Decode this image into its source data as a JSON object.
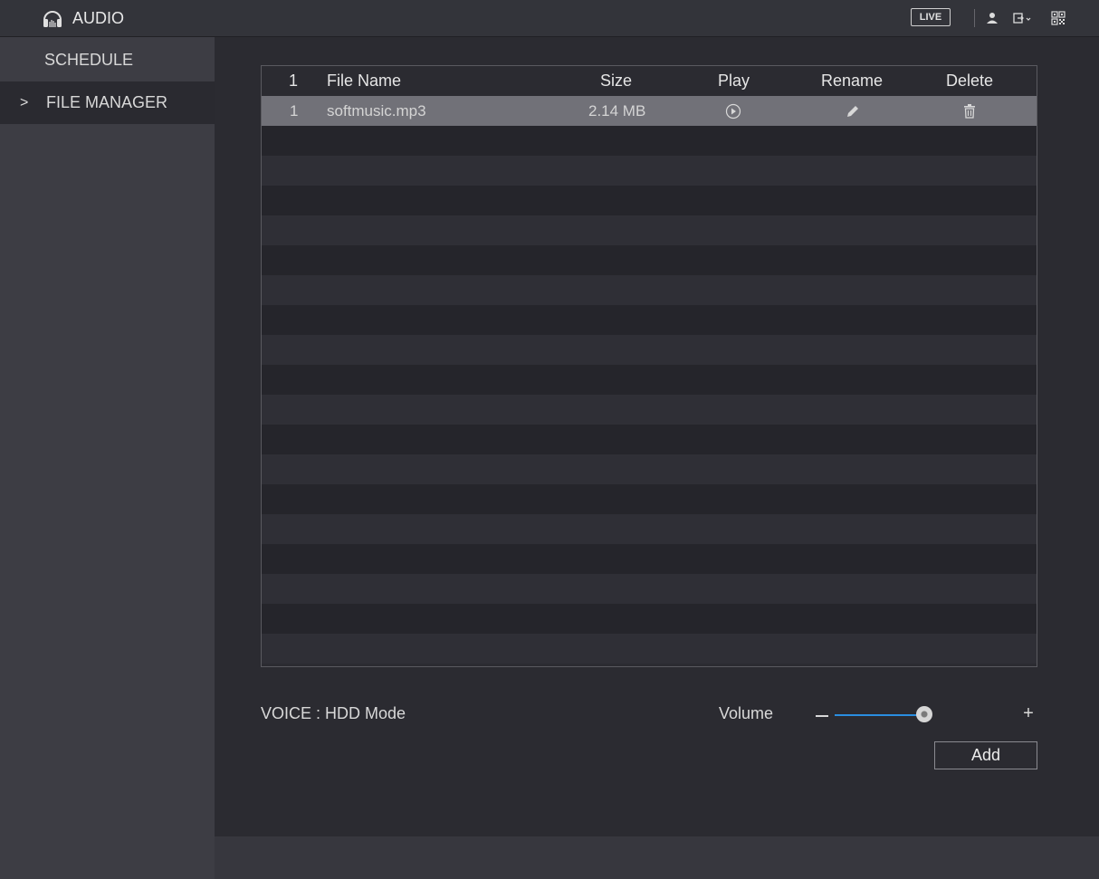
{
  "app": {
    "title": "AUDIO",
    "icon": "headphones-icon"
  },
  "topbar": {
    "live_label": "LIVE",
    "icons": [
      "user-icon",
      "logout-icon",
      "qr-code-icon"
    ]
  },
  "sidebar": {
    "items": [
      {
        "label": "SCHEDULE",
        "active": false
      },
      {
        "label": "FILE MANAGER",
        "active": true
      }
    ],
    "active_marker": ">"
  },
  "table": {
    "headers": {
      "index": "1",
      "name": "File Name",
      "size": "Size",
      "play": "Play",
      "rename": "Rename",
      "delete": "Delete"
    },
    "rows": [
      {
        "index": "1",
        "name": "softmusic.mp3",
        "size": "2.14 MB"
      }
    ]
  },
  "voice": {
    "label": "VOICE : HDD Mode"
  },
  "volume": {
    "label": "Volume",
    "minus": "−",
    "plus": "+",
    "level": 1.0
  },
  "actions": {
    "add_label": "Add"
  },
  "colors": {
    "accent": "#2a8ee0",
    "selected_row": "#717178",
    "sidebar_bg": "#3d3d44"
  }
}
